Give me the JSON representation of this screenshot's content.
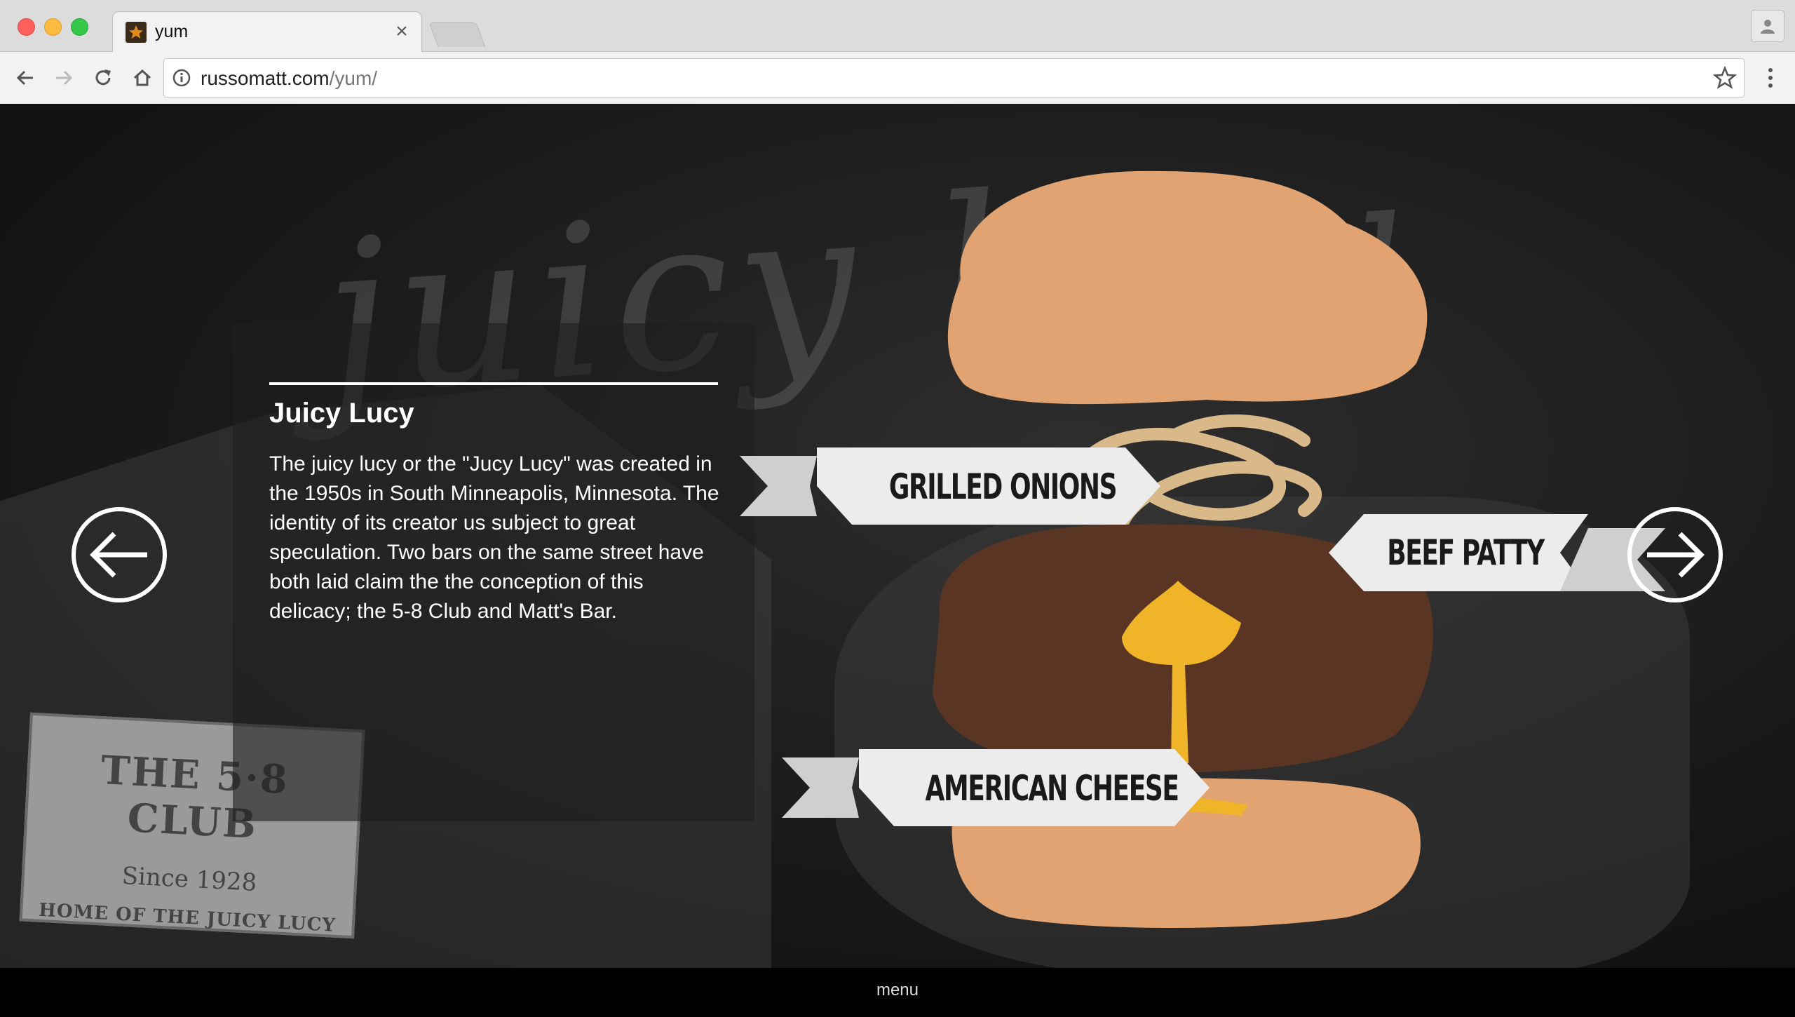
{
  "browser": {
    "tab_title": "yum",
    "tab_close": "×",
    "url_host": "russomatt.com",
    "url_path": "/yum/"
  },
  "page": {
    "background_word": "juicy lucy",
    "sign": {
      "line1": "THE 5·8 CLUB",
      "line2": "Since 1928",
      "line3": "HOME OF THE JUICY LUCY"
    },
    "info": {
      "title": "Juicy Lucy",
      "body": "The juicy lucy or the \"Jucy Lucy\" was created in the 1950s in South Minneapolis, Minnesota. The identity of its creator us subject to great speculation. Two bars on the same street have both laid claim the the conception of this delicacy; the 5-8 Club and Matt's Bar."
    },
    "labels": {
      "onions": "GRILLED ONIONS",
      "patty": "BEEF PATTY",
      "cheese": "AMERICAN CHEESE"
    },
    "menu_label": "menu"
  },
  "colors": {
    "bun": "#e0a371",
    "patty": "#5a3524",
    "cheese": "#f0b429",
    "onion": "#d9b98a",
    "banner": "#ececec"
  }
}
